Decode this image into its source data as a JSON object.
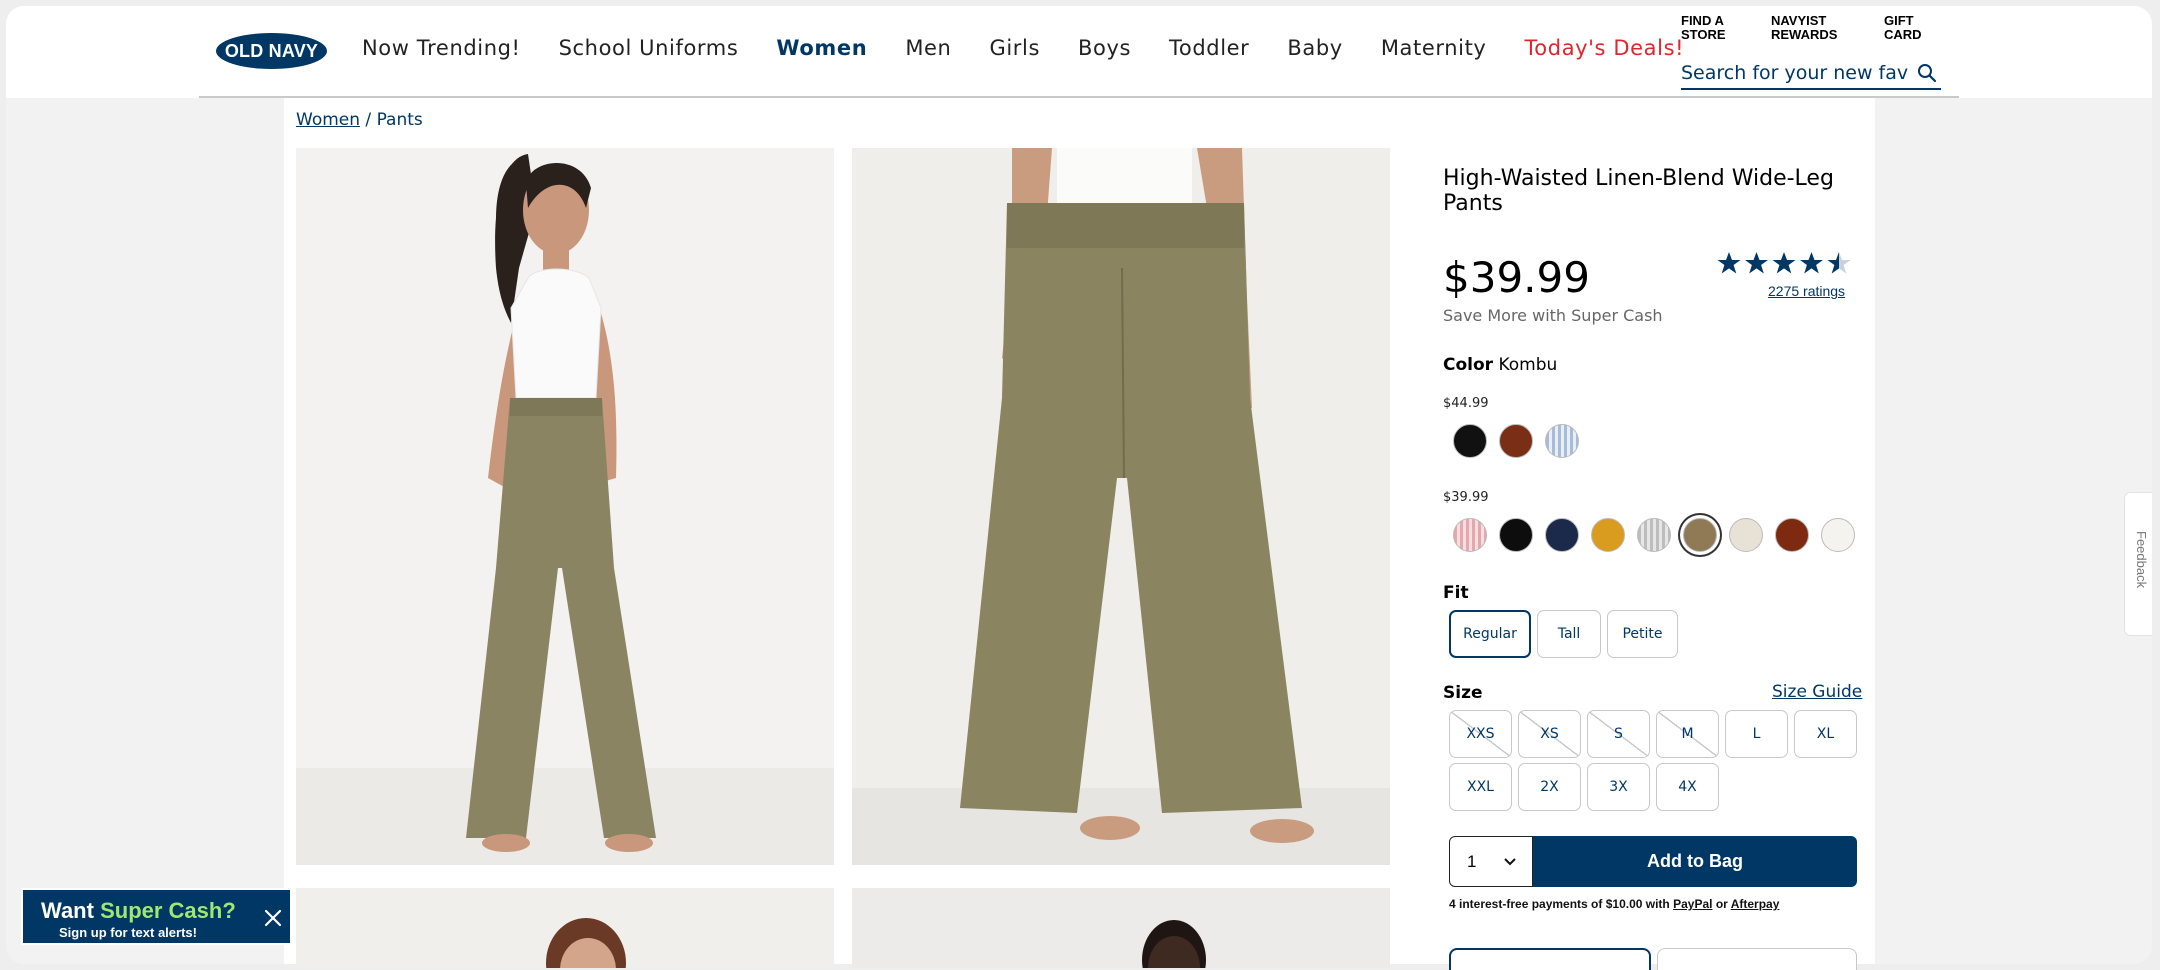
{
  "header": {
    "logo": "OLD NAVY",
    "nav": [
      {
        "label": "Now Trending!"
      },
      {
        "label": "School Uniforms"
      },
      {
        "label": "Women"
      },
      {
        "label": "Men"
      },
      {
        "label": "Girls"
      },
      {
        "label": "Boys"
      },
      {
        "label": "Toddler"
      },
      {
        "label": "Baby"
      },
      {
        "label": "Maternity"
      },
      {
        "label": "Today's Deals!"
      }
    ],
    "utility": {
      "find_store_1": "FIND A",
      "find_store_2": "STORE",
      "rewards_1": "NAVYIST",
      "rewards_2": "REWARDS",
      "gift_1": "GIFT",
      "gift_2": "CARD"
    },
    "search_placeholder": "Search for your new fave",
    "colors": {
      "brand": "#003764",
      "deal": "#e1252f"
    }
  },
  "breadcrumb": {
    "parent": "Women",
    "separator": " / ",
    "current": "Pants"
  },
  "product": {
    "title": "High-Waisted Linen-Blend Wide-Leg Pants",
    "price": "$39.99",
    "super_cash": "Save More with Super Cash",
    "rating": 4.5,
    "ratings_count": "2275 ratings",
    "color_label": "Color",
    "color_value": "Kombu",
    "tiers": [
      {
        "price": "$44.99",
        "swatches": [
          "#111111",
          "#7a2e16",
          "#a7bcd6"
        ]
      },
      {
        "price": "$39.99",
        "swatches": [
          "#e4a7ad",
          "#0d0d0d",
          "#1b2a4a",
          "#d99c1e",
          "#bdbdbd",
          "#8f7a55",
          "#e8e1d6",
          "#7e2a10",
          "#f4f3ef"
        ],
        "selected_index": 5
      }
    ],
    "fit_label": "Fit",
    "fits": [
      "Regular",
      "Tall",
      "Petite"
    ],
    "fit_selected": "Regular",
    "size_label": "Size",
    "size_guide": "Size Guide",
    "sizes_row1": [
      {
        "label": "XXS",
        "available": false
      },
      {
        "label": "XS",
        "available": false
      },
      {
        "label": "S",
        "available": false
      },
      {
        "label": "M",
        "available": false
      },
      {
        "label": "L",
        "available": true
      },
      {
        "label": "XL",
        "available": true
      }
    ],
    "sizes_row2": [
      {
        "label": "XXL",
        "available": true
      },
      {
        "label": "2X",
        "available": true
      },
      {
        "label": "3X",
        "available": true
      },
      {
        "label": "4X",
        "available": true
      }
    ],
    "quantity": "1",
    "add_to_bag": "Add to Bag",
    "installment": {
      "prefix": "4 interest-free payments of $10.00 with",
      "paypal": "PayPal",
      "or": "or",
      "afterpay": "Afterpay"
    }
  },
  "feedback": "Feedback",
  "promo": {
    "want": "Want",
    "super_cash": "Super Cash?",
    "signup": "Sign up for text alerts!"
  }
}
